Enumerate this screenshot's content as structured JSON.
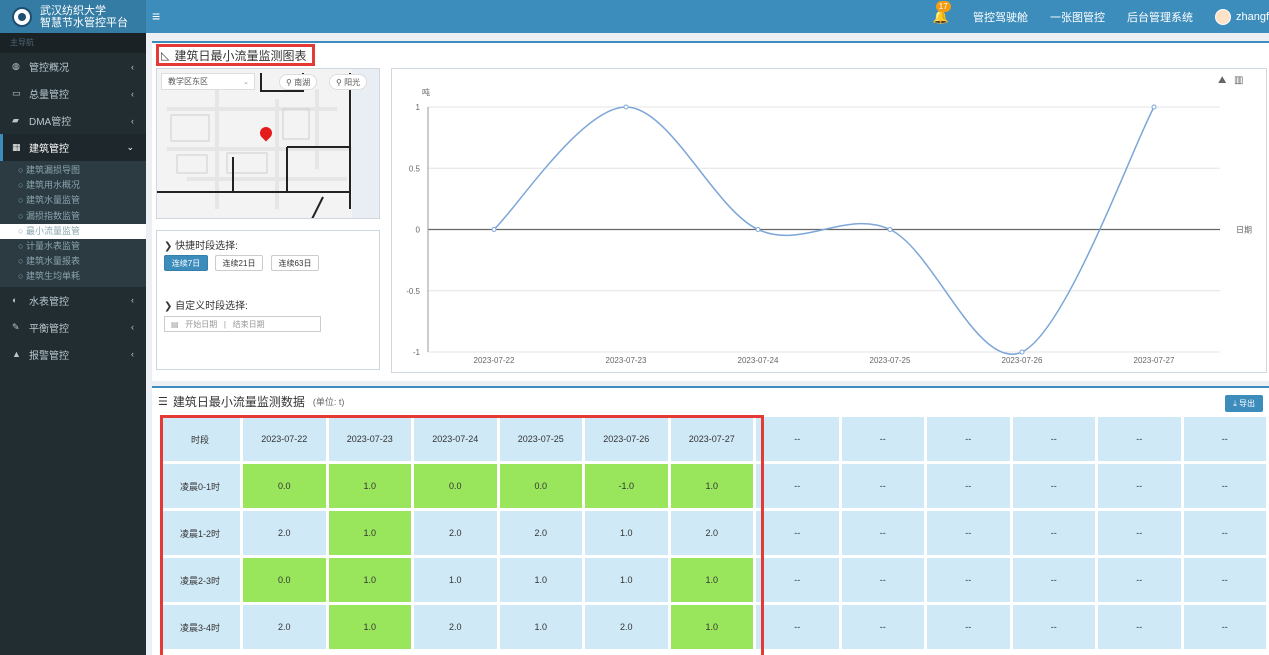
{
  "header": {
    "logo_line1": "武汉纺织大学",
    "logo_line2": "智慧节水管控平台",
    "menu_icon": "hamburger-icon",
    "bell_badge": "17",
    "links": [
      "管控驾驶舱",
      "一张图管控",
      "后台管理系统"
    ],
    "user": "zhangf"
  },
  "sidebar": {
    "header": "主导航",
    "items": [
      {
        "label": "管控概况",
        "icon": "dashboard-icon"
      },
      {
        "label": "总量管控",
        "icon": "monitor-icon"
      },
      {
        "label": "DMA管控",
        "icon": "book-icon"
      },
      {
        "label": "建筑管控",
        "icon": "calendar-icon"
      }
    ],
    "sub_items": [
      "建筑漏损导图",
      "建筑用水概况",
      "建筑水量监管",
      "漏损指数监管",
      "最小流量监管",
      "计量水表监管",
      "建筑水量报表",
      "建筑生均单耗"
    ],
    "items_after": [
      {
        "label": "水表管控",
        "icon": "gauge-icon"
      },
      {
        "label": "平衡管控",
        "icon": "edit-icon"
      },
      {
        "label": "报警管控",
        "icon": "warning-icon"
      }
    ]
  },
  "chart_box": {
    "title": "建筑日最小流量监测图表"
  },
  "map": {
    "select_value": "教学区东区",
    "btn_south": "南湖",
    "btn_sun": "阳光"
  },
  "quick": {
    "label1": "快捷时段选择:",
    "btn1": "连续7日",
    "btn2": "连续21日",
    "btn3": "连续63日",
    "label2": "自定义时段选择:",
    "start_placeholder": "开始日期",
    "sep": "|",
    "end_placeholder": "结束日期"
  },
  "chart_data": {
    "type": "line",
    "x": [
      "2023-07-22",
      "2023-07-23",
      "2023-07-24",
      "2023-07-25",
      "2023-07-26",
      "2023-07-27"
    ],
    "series": [
      {
        "values": [
          0,
          1,
          0,
          0,
          -1,
          1
        ]
      }
    ],
    "ylabel": "吨",
    "xlabel": "日期",
    "ylim": [
      -1,
      1
    ],
    "yticks": [
      1,
      0.5,
      0,
      -0.5,
      -1
    ],
    "ytick_labels": [
      "1",
      "0.5",
      "0",
      "-0.5",
      "-1"
    ],
    "color": "#7ca6d8",
    "grid": true
  },
  "table_box": {
    "title": "建筑日最小流量监测数据",
    "unit": "(单位: t)",
    "export_label": "导出",
    "header": [
      "时段",
      "2023-07-22",
      "2023-07-23",
      "2023-07-24",
      "2023-07-25",
      "2023-07-26",
      "2023-07-27",
      "--",
      "--",
      "--",
      "--",
      "--",
      "--"
    ],
    "rows": [
      {
        "label": "凌晨0-1时",
        "values": [
          "0.0",
          "1.0",
          "0.0",
          "0.0",
          "-1.0",
          "1.0",
          "--",
          "--",
          "--",
          "--",
          "--",
          "--"
        ],
        "green": [
          1,
          1,
          1,
          1,
          1,
          1,
          0,
          0,
          0,
          0,
          0,
          0
        ]
      },
      {
        "label": "凌晨1-2时",
        "values": [
          "2.0",
          "1.0",
          "2.0",
          "2.0",
          "1.0",
          "2.0",
          "--",
          "--",
          "--",
          "--",
          "--",
          "--"
        ],
        "green": [
          0,
          1,
          0,
          0,
          0,
          0,
          0,
          0,
          0,
          0,
          0,
          0
        ]
      },
      {
        "label": "凌晨2-3时",
        "values": [
          "0.0",
          "1.0",
          "1.0",
          "1.0",
          "1.0",
          "1.0",
          "--",
          "--",
          "--",
          "--",
          "--",
          "--"
        ],
        "green": [
          1,
          1,
          0,
          0,
          0,
          1,
          0,
          0,
          0,
          0,
          0,
          0
        ]
      },
      {
        "label": "凌晨3-4时",
        "values": [
          "2.0",
          "1.0",
          "2.0",
          "1.0",
          "2.0",
          "1.0",
          "--",
          "--",
          "--",
          "--",
          "--",
          "--"
        ],
        "green": [
          0,
          1,
          0,
          0,
          0,
          1,
          0,
          0,
          0,
          0,
          0,
          0
        ]
      }
    ],
    "green_color": "#99e65c",
    "cell_color": "#d0e9f6"
  }
}
